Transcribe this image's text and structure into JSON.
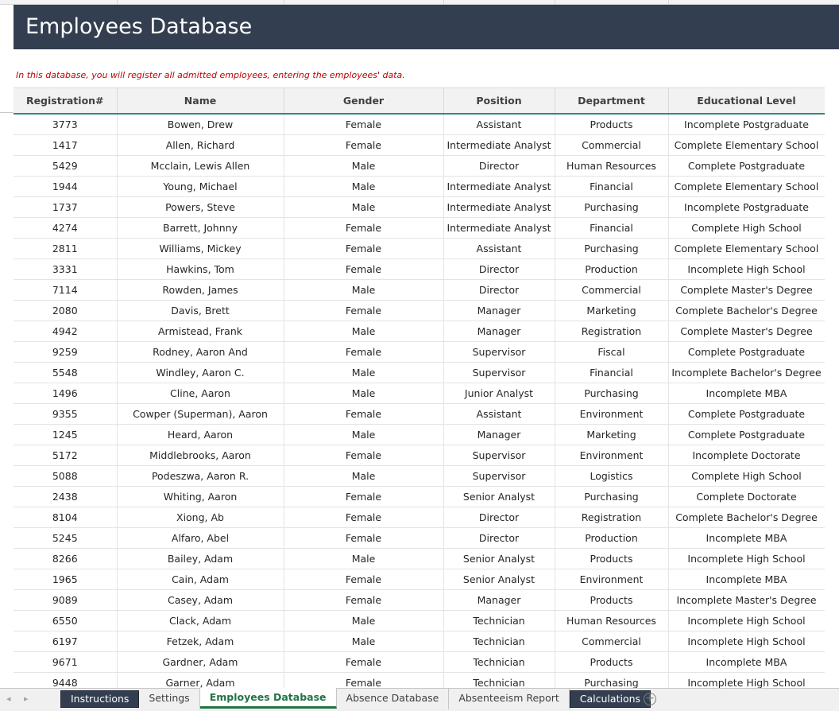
{
  "sheet": {
    "title": "Employees Database",
    "subtitle": "In this database, you will register all admitted employees, entering the employees' data."
  },
  "table": {
    "columns": [
      "Registration#",
      "Name",
      "Gender",
      "Position",
      "Department",
      "Educational Level"
    ],
    "rows": [
      [
        "3773",
        "Bowen, Drew",
        "Female",
        "Assistant",
        "Products",
        "Incomplete Postgraduate"
      ],
      [
        "1417",
        "Allen, Richard",
        "Female",
        "Intermediate Analyst",
        "Commercial",
        "Complete Elementary School"
      ],
      [
        "5429",
        "Mcclain, Lewis Allen",
        "Male",
        "Director",
        "Human Resources",
        "Complete Postgraduate"
      ],
      [
        "1944",
        "Young, Michael",
        "Male",
        "Intermediate Analyst",
        "Financial",
        "Complete Elementary School"
      ],
      [
        "1737",
        "Powers, Steve",
        "Male",
        "Intermediate Analyst",
        "Purchasing",
        "Incomplete Postgraduate"
      ],
      [
        "4274",
        "Barrett, Johnny",
        "Female",
        "Intermediate Analyst",
        "Financial",
        "Complete High School"
      ],
      [
        "2811",
        "Williams, Mickey",
        "Female",
        "Assistant",
        "Purchasing",
        "Complete Elementary School"
      ],
      [
        "3331",
        "Hawkins, Tom",
        "Female",
        "Director",
        "Production",
        "Incomplete High School"
      ],
      [
        "7114",
        "Rowden, James",
        "Male",
        "Director",
        "Commercial",
        "Complete Master's Degree"
      ],
      [
        "2080",
        "Davis, Brett",
        "Female",
        "Manager",
        "Marketing",
        "Complete Bachelor's Degree"
      ],
      [
        "4942",
        "Armistead, Frank",
        "Male",
        "Manager",
        "Registration",
        "Complete Master's Degree"
      ],
      [
        "9259",
        "Rodney, Aaron And",
        "Female",
        "Supervisor",
        "Fiscal",
        "Complete Postgraduate"
      ],
      [
        "5548",
        "Windley, Aaron C.",
        "Male",
        "Supervisor",
        "Financial",
        "Incomplete Bachelor's Degree"
      ],
      [
        "1496",
        "Cline, Aaron",
        "Male",
        "Junior Analyst",
        "Purchasing",
        "Incomplete MBA"
      ],
      [
        "9355",
        "Cowper (Superman), Aaron",
        "Female",
        "Assistant",
        "Environment",
        "Complete Postgraduate"
      ],
      [
        "1245",
        "Heard, Aaron",
        "Male",
        "Manager",
        "Marketing",
        "Complete Postgraduate"
      ],
      [
        "5172",
        "Middlebrooks, Aaron",
        "Female",
        "Supervisor",
        "Environment",
        "Incomplete Doctorate"
      ],
      [
        "5088",
        "Podeszwa, Aaron R.",
        "Male",
        "Supervisor",
        "Logistics",
        "Complete High School"
      ],
      [
        "2438",
        "Whiting, Aaron",
        "Female",
        "Senior Analyst",
        "Purchasing",
        "Complete Doctorate"
      ],
      [
        "8104",
        "Xiong, Ab",
        "Female",
        "Director",
        "Registration",
        "Complete Bachelor's Degree"
      ],
      [
        "5245",
        "Alfaro, Abel",
        "Female",
        "Director",
        "Production",
        "Incomplete MBA"
      ],
      [
        "8266",
        "Bailey, Adam",
        "Male",
        "Senior Analyst",
        "Products",
        "Incomplete High School"
      ],
      [
        "1965",
        "Cain, Adam",
        "Female",
        "Senior Analyst",
        "Environment",
        "Incomplete MBA"
      ],
      [
        "9089",
        "Casey, Adam",
        "Female",
        "Manager",
        "Products",
        "Incomplete Master's Degree"
      ],
      [
        "6550",
        "Clack, Adam",
        "Male",
        "Technician",
        "Human Resources",
        "Incomplete High School"
      ],
      [
        "6197",
        "Fetzek, Adam",
        "Male",
        "Technician",
        "Commercial",
        "Incomplete High School"
      ],
      [
        "9671",
        "Gardner, Adam",
        "Female",
        "Technician",
        "Products",
        "Incomplete MBA"
      ],
      [
        "9448",
        "Garner, Adam",
        "Female",
        "Technician",
        "Purchasing",
        "Incomplete High School"
      ]
    ]
  },
  "tabs": [
    {
      "label": "Instructions",
      "style": "dark"
    },
    {
      "label": "Settings",
      "style": "plain"
    },
    {
      "label": "Employees Database",
      "style": "active"
    },
    {
      "label": "Absence Database",
      "style": "plain"
    },
    {
      "label": "Absenteeism Report",
      "style": "plain"
    },
    {
      "label": "Calculations",
      "style": "dark"
    }
  ],
  "nav": {
    "prev": "◂",
    "next": "▸",
    "add_sheet": "+"
  },
  "colors": {
    "title_bg": "#333f50",
    "accent": "#217346",
    "subtitle": "#c00000",
    "header_rule": "#2e8b7a"
  },
  "icons": [
    "sheet-prev-icon",
    "sheet-next-icon",
    "add-sheet-icon"
  ]
}
